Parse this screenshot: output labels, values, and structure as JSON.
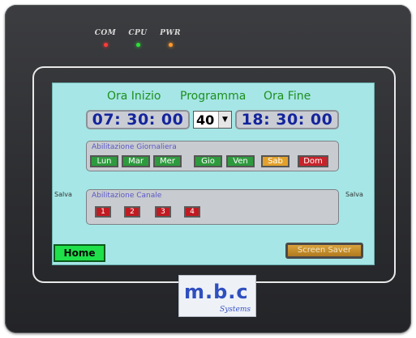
{
  "indicators": [
    {
      "label": "COM",
      "color": "#ff3b3b"
    },
    {
      "label": "CPU",
      "color": "#2ee03a"
    },
    {
      "label": "PWR",
      "color": "#ff9a2a"
    }
  ],
  "header": {
    "start_label": "Ora Inizio",
    "program_label": "Programma",
    "end_label": "Ora Fine"
  },
  "times": {
    "start": "07: 30: 00",
    "end": "18: 30: 00"
  },
  "program": {
    "selected": "40"
  },
  "daily": {
    "title": "Abilitazione Giornaliera",
    "days": [
      {
        "label": "Lun",
        "color": "#2e9a3e"
      },
      {
        "label": "Mar",
        "color": "#2e9a3e"
      },
      {
        "label": "Mer",
        "color": "#2e9a3e"
      },
      {
        "label": "Gio",
        "color": "#2e9a3e"
      },
      {
        "label": "Ven",
        "color": "#2e9a3e"
      },
      {
        "label": "Sab",
        "color": "#e2a12c"
      },
      {
        "label": "Dom",
        "color": "#c8232a"
      }
    ]
  },
  "channels": {
    "title": "Abilitazione Canale",
    "items": [
      "1",
      "2",
      "3",
      "4"
    ]
  },
  "side": {
    "left_label": "Salva",
    "right_label": "Salva"
  },
  "buttons": {
    "home": "Home",
    "screen_saver": "Screen Saver"
  },
  "logo": {
    "main": "m.b.c",
    "sub": "Systems"
  }
}
